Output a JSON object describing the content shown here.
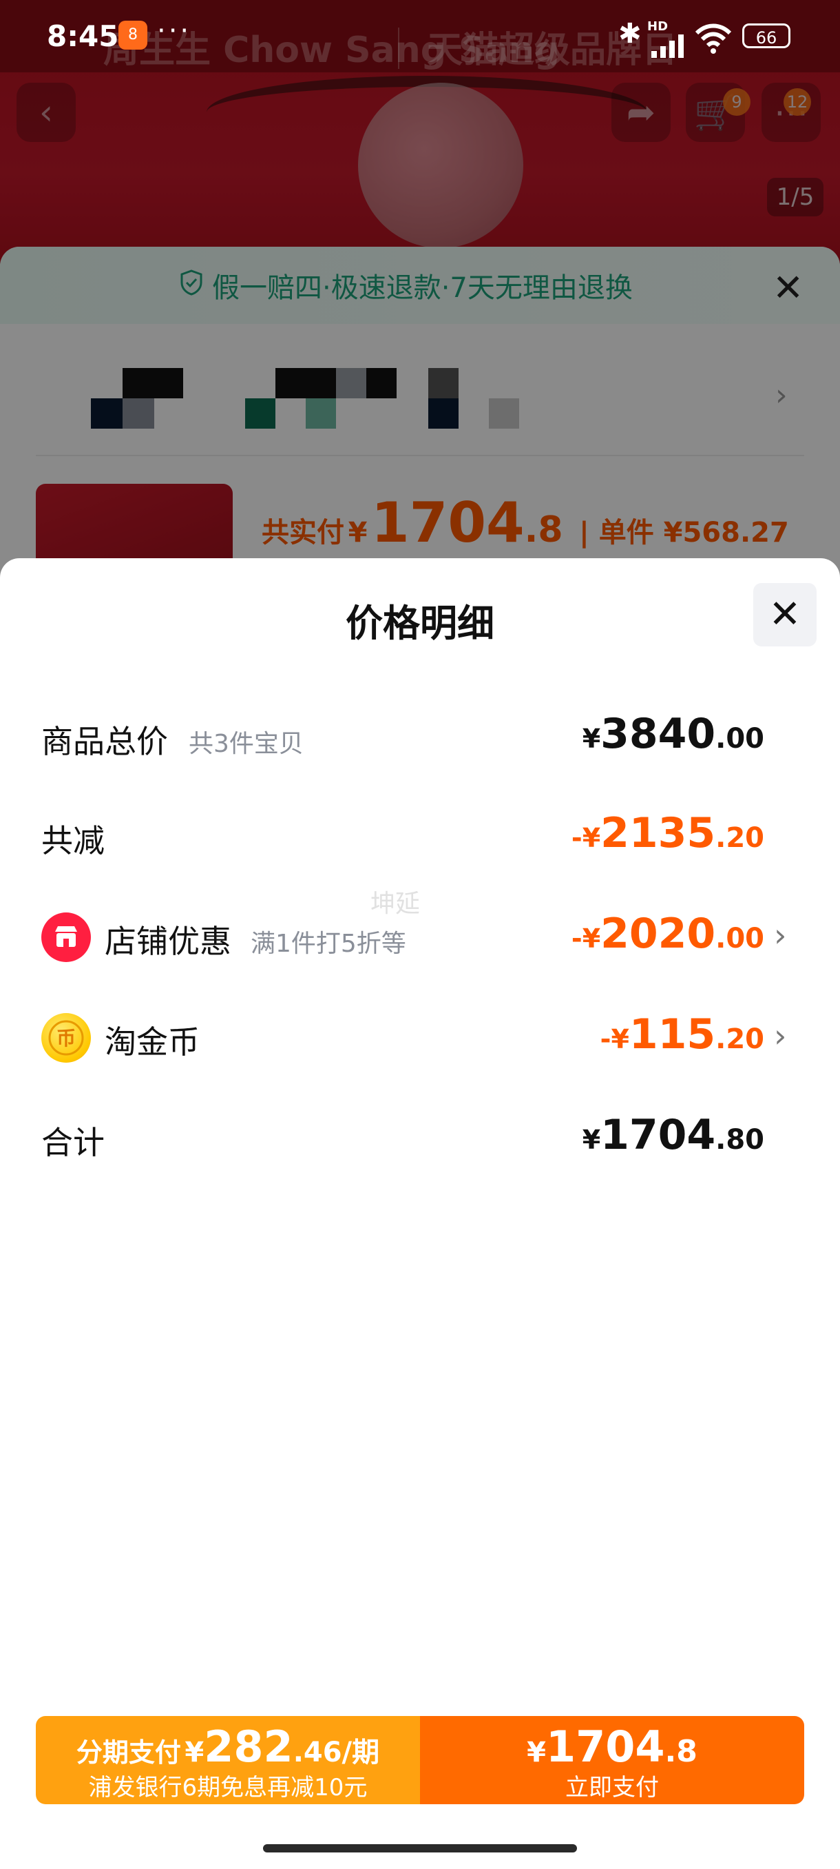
{
  "status_bar": {
    "time": "8:45",
    "app_badge": "8",
    "overflow": "···",
    "network": "HD",
    "battery": "66"
  },
  "background": {
    "brand_left": "周生生 Chow Sang Sang",
    "brand_right": "天猫超级品牌日",
    "cart_badge": "9",
    "more_badge": "12",
    "image_counter": "1/5",
    "guarantee": "假一赔四·极速退款·7天无理由退换",
    "paid_label": "共实付",
    "paid_currency": "¥",
    "paid_int": "1704",
    "paid_dec": ".8",
    "unit_label": "| 单件 ¥568.27"
  },
  "sheet": {
    "title": "价格明细",
    "rows": [
      {
        "label": "商品总价",
        "note": "共3件宝贝",
        "currency": "¥",
        "int": "3840",
        "dec": ".00"
      },
      {
        "label": "共减",
        "currency": "-¥",
        "int": "2135",
        "dec": ".20"
      },
      {
        "label": "店铺优惠",
        "note": "满1件打5折等",
        "currency": "-¥",
        "int": "2020",
        "dec": ".00"
      },
      {
        "label": "淘金币",
        "currency": "-¥",
        "int": "115",
        "dec": ".20"
      },
      {
        "label": "合计",
        "currency": "¥",
        "int": "1704",
        "dec": ".80"
      }
    ],
    "watermark": "坤延"
  },
  "bottom_bar": {
    "installment_text": "分期支付",
    "installment_currency": "¥",
    "installment_int": "282",
    "installment_dec": ".46/期",
    "installment_sub": "浦发银行6期免息再减10元",
    "pay_currency": "¥",
    "pay_int": "1704",
    "pay_dec": ".8",
    "pay_label": "立即支付"
  },
  "colors": {
    "accent_orange": "#ff5a00",
    "installment_bg": "#ffa110",
    "pay_bg": "#ff6a00",
    "shop_icon": "#ff1f40",
    "coin_icon": "#ffc800"
  }
}
